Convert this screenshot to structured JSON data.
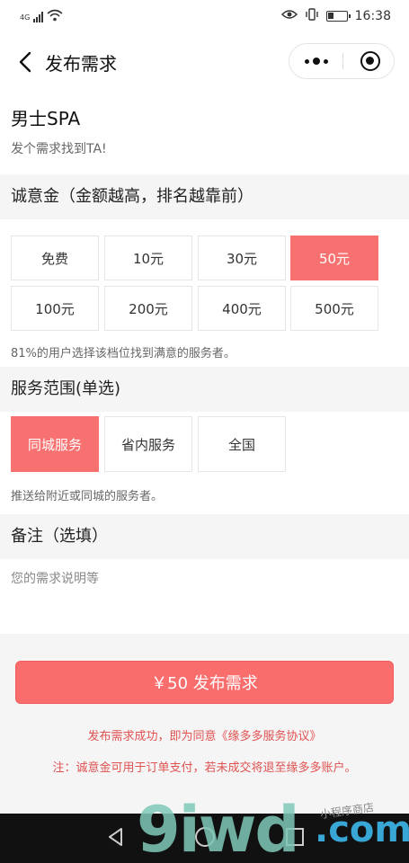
{
  "statusbar": {
    "network": "4G",
    "time": "16:38"
  },
  "navbar": {
    "title": "发布需求"
  },
  "service": {
    "title": "男士SPA",
    "subtitle": "发个需求找到TA!"
  },
  "deposit": {
    "heading": "诚意金（金额越高，排名越靠前）",
    "options": [
      "免费",
      "10元",
      "30元",
      "50元",
      "100元",
      "200元",
      "400元",
      "500元"
    ],
    "selected": "50元",
    "hint": "81%的用户选择该档位找到满意的服务者。"
  },
  "scope": {
    "heading": "服务范围(单选)",
    "options": [
      "同城服务",
      "省内服务",
      "全国"
    ],
    "selected": "同城服务",
    "hint": "推送给附近或同城的服务者。"
  },
  "remark": {
    "heading": "备注（选填）",
    "placeholder": "您的需求说明等"
  },
  "submit": {
    "label": "￥50 发布需求"
  },
  "notices": {
    "agreement": "发布需求成功，即为同意《缘多多服务协议》",
    "refund": "注：诚意金可用于订单支付，若未成交将退至缘多多账户。"
  },
  "watermark": {
    "main": "9iwd",
    "domain": ".com",
    "small": "小程序商店"
  },
  "colors": {
    "accent": "#f87171",
    "notice": "#e05252"
  }
}
